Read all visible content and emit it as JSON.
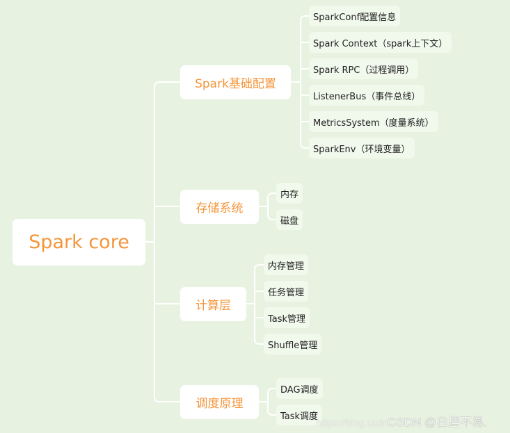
{
  "root": {
    "label": "Spark core"
  },
  "branches": [
    {
      "label": "Spark基础配置",
      "children": [
        "SparkConf配置信息",
        "Spark Context（spark上下文）",
        "Spark RPC（过程调用）",
        "ListenerBus（事件总线）",
        "MetricsSystem（度量系统）",
        "SparkEnv（环境变量）"
      ]
    },
    {
      "label": "存储系统",
      "children": [
        "内存",
        "磁盘"
      ]
    },
    {
      "label": "计算层",
      "children": [
        "内存管理",
        "任务管理",
        "Task管理",
        "Shuffle管理"
      ]
    },
    {
      "label": "调度原理",
      "children": [
        "DAG调度",
        "Task调度"
      ]
    }
  ],
  "watermark": {
    "url": "https://blog.csdn",
    "brand": "CSDN @白居不易."
  },
  "colors": {
    "background": "#e8f2e1",
    "accent": "#f5953a",
    "connector": "#ffffff"
  }
}
